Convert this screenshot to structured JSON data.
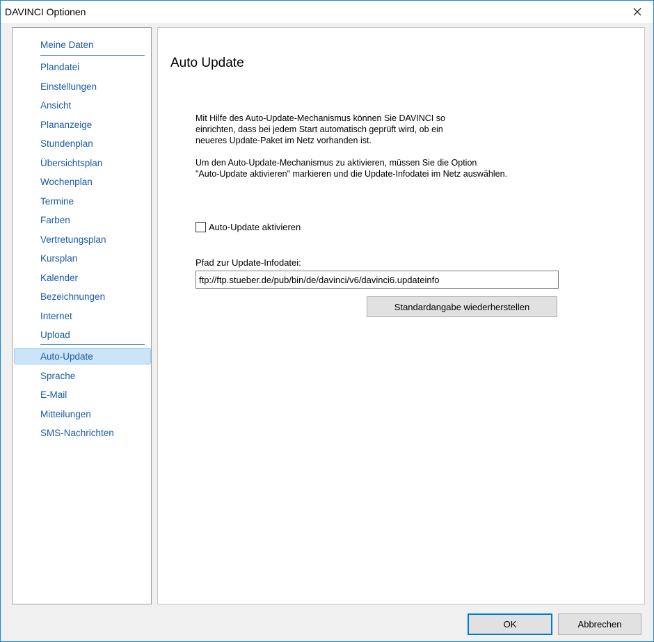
{
  "window": {
    "title": "DAVINCI Optionen"
  },
  "sidebar": {
    "items": [
      {
        "label": "Meine Daten"
      },
      {
        "label": "Plandatei"
      },
      {
        "label": "Einstellungen"
      },
      {
        "label": "Ansicht"
      },
      {
        "label": "Plananzeige"
      },
      {
        "label": "Stundenplan"
      },
      {
        "label": "Übersichtsplan"
      },
      {
        "label": "Wochenplan"
      },
      {
        "label": "Termine"
      },
      {
        "label": "Farben"
      },
      {
        "label": "Vertretungsplan"
      },
      {
        "label": "Kursplan"
      },
      {
        "label": "Kalender"
      },
      {
        "label": "Bezeichnungen"
      },
      {
        "label": "Internet"
      },
      {
        "label": "Upload"
      },
      {
        "label": "Auto-Update"
      },
      {
        "label": "Sprache"
      },
      {
        "label": "E-Mail"
      },
      {
        "label": "Mitteilungen"
      },
      {
        "label": "SMS-Nachrichten"
      }
    ],
    "selected": "Auto-Update"
  },
  "main": {
    "title": "Auto Update",
    "paragraph1": [
      "Mit Hilfe des Auto-Update-Mechanismus können Sie DAVINCI so",
      "einrichten, dass bei jedem Start automatisch geprüft wird, ob ein",
      "neueres Update-Paket im Netz vorhanden ist."
    ],
    "paragraph2": [
      "Um den Auto-Update-Mechanismus zu aktivieren, müssen Sie die Option",
      "\"Auto-Update aktivieren\" markieren und die Update-Infodatei im Netz auswählen."
    ],
    "checkbox_label": "Auto-Update aktivieren",
    "checkbox_checked": false,
    "path_label": "Pfad zur Update-Infodatei:",
    "path_value": "ftp://ftp.stueber.de/pub/bin/de/davinci/v6/davinci6.updateinfo",
    "restore_button": "Standardangabe wiederherstellen"
  },
  "footer": {
    "ok_label": "OK",
    "cancel_label": "Abbrechen"
  },
  "colors": {
    "accent": "#0078d7",
    "nav_text": "#1a5aa8",
    "selected_bg": "#cce4f7"
  }
}
